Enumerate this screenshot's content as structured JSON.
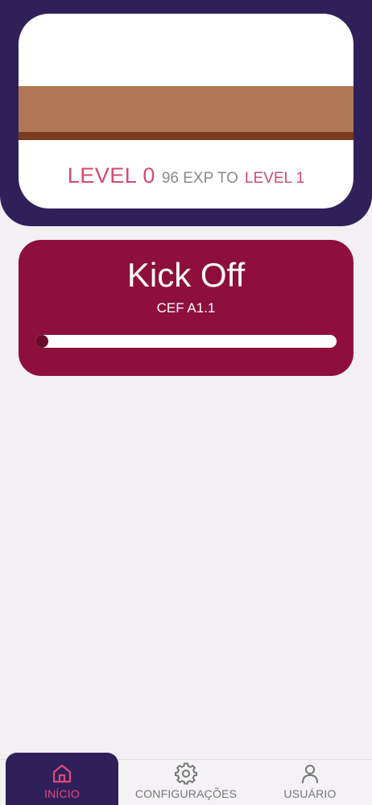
{
  "level_card": {
    "current_level": "LEVEL 0",
    "exp_text": "96 EXP TO",
    "next_level": "LEVEL 1"
  },
  "lesson": {
    "title": "Kick Off",
    "subtitle": "CEF A1.1",
    "progress": 0.02
  },
  "bottom_nav": {
    "items": [
      {
        "label": "INÍCIO",
        "icon": "home-icon",
        "active": true
      },
      {
        "label": "CONFIGURAÇÕES",
        "icon": "gear-icon",
        "active": false
      },
      {
        "label": "USUÁRIO",
        "icon": "user-icon",
        "active": false
      }
    ]
  },
  "colors": {
    "primary": "#30205a",
    "lesson_card": "#8e0f3c",
    "accent": "#d44a72",
    "ground": "#b07756",
    "ground_edge": "#7a3c1f"
  }
}
